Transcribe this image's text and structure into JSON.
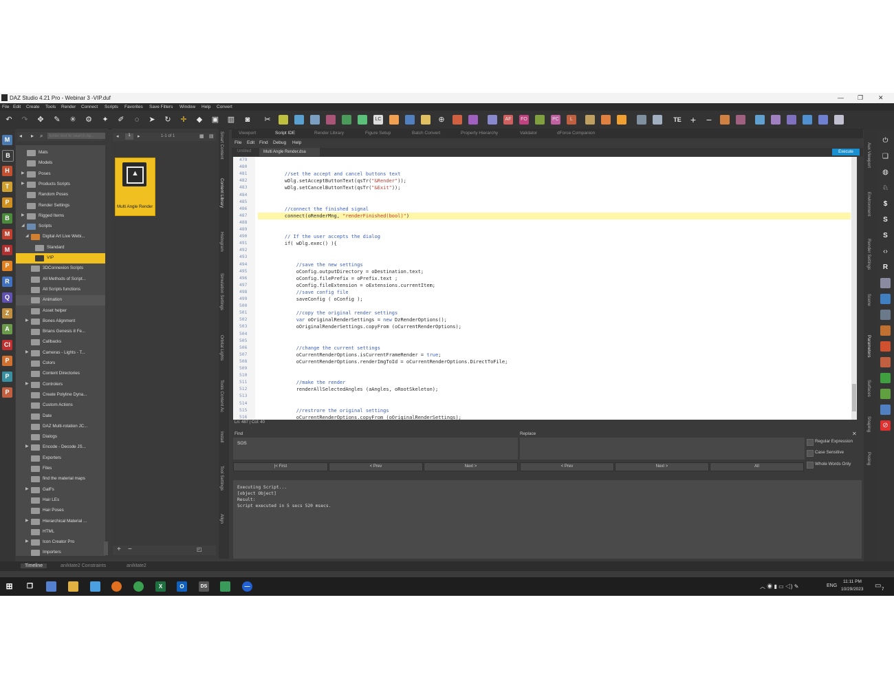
{
  "window": {
    "title": "DAZ Studio 4.21 Pro - Webinar 3 -VIP.duf",
    "minimize": "—",
    "maximize": "❐",
    "close": "✕"
  },
  "menu": [
    "File",
    "Edit",
    "Create",
    "Tools",
    "Render",
    "Connect",
    "Scripts",
    "Favorites",
    "Save Filters",
    "Window",
    "Help",
    "Convert"
  ],
  "left_icons": [
    "M",
    "B",
    "H",
    "T",
    "P",
    "B",
    "M",
    "M",
    "P",
    "R",
    "Q",
    "Z",
    "A",
    "Cl",
    "P",
    "P",
    "P"
  ],
  "content_library": {
    "search_placeholder": "Enter text to search by...",
    "items": [
      {
        "label": "Mats",
        "indent": 1,
        "arrow": ""
      },
      {
        "label": "Models",
        "indent": 1,
        "arrow": ""
      },
      {
        "label": "Poses",
        "indent": 1,
        "arrow": "▶"
      },
      {
        "label": "Products Scripts",
        "indent": 1,
        "arrow": "▶"
      },
      {
        "label": "Random Poses",
        "indent": 1,
        "arrow": ""
      },
      {
        "label": "Render Settings",
        "indent": 1,
        "arrow": ""
      },
      {
        "label": "Rigged Items",
        "indent": 1,
        "arrow": "▶"
      },
      {
        "label": "Scripts",
        "indent": 1,
        "arrow": "◢"
      },
      {
        "label": "Digital Art Live Webi...",
        "indent": 2,
        "arrow": "◢"
      },
      {
        "label": "Standard",
        "indent": 3,
        "arrow": ""
      },
      {
        "label": "VIP",
        "indent": 3,
        "arrow": "",
        "selected": true
      },
      {
        "label": "3DConnexion Scripts",
        "indent": 2,
        "arrow": ""
      },
      {
        "label": "All Methods of Script...",
        "indent": 2,
        "arrow": ""
      },
      {
        "label": "All Scripts functions",
        "indent": 2,
        "arrow": ""
      },
      {
        "label": "Animation",
        "indent": 2,
        "arrow": "",
        "highlight": true
      },
      {
        "label": "Asset helper",
        "indent": 2,
        "arrow": ""
      },
      {
        "label": "Bones Alignment",
        "indent": 2,
        "arrow": "▶"
      },
      {
        "label": "Brians Genesis 8 Fe...",
        "indent": 2,
        "arrow": ""
      },
      {
        "label": "Callbacks",
        "indent": 2,
        "arrow": ""
      },
      {
        "label": "Cameras - Lights - T...",
        "indent": 2,
        "arrow": "▶"
      },
      {
        "label": "Colors",
        "indent": 2,
        "arrow": ""
      },
      {
        "label": "Content Directories",
        "indent": 2,
        "arrow": ""
      },
      {
        "label": "Controlers",
        "indent": 2,
        "arrow": "▶"
      },
      {
        "label": "Create Polyline Dyna...",
        "indent": 2,
        "arrow": ""
      },
      {
        "label": "Custom Actions",
        "indent": 2,
        "arrow": ""
      },
      {
        "label": "Date",
        "indent": 2,
        "arrow": ""
      },
      {
        "label": "DAZ Multi-rotation JC...",
        "indent": 2,
        "arrow": ""
      },
      {
        "label": "Dialogs",
        "indent": 2,
        "arrow": ""
      },
      {
        "label": "Encode - Decode JS...",
        "indent": 2,
        "arrow": "▶"
      },
      {
        "label": "Exporters",
        "indent": 2,
        "arrow": ""
      },
      {
        "label": "Files",
        "indent": 2,
        "arrow": ""
      },
      {
        "label": "find the material maps",
        "indent": 2,
        "arrow": ""
      },
      {
        "label": "GalFs",
        "indent": 2,
        "arrow": "▶"
      },
      {
        "label": "Hair LEs",
        "indent": 2,
        "arrow": ""
      },
      {
        "label": "Hair Poses",
        "indent": 2,
        "arrow": ""
      },
      {
        "label": "Hierarchical Material ...",
        "indent": 2,
        "arrow": "▶"
      },
      {
        "label": "HTML",
        "indent": 2,
        "arrow": ""
      },
      {
        "label": "Icon Creator Pro",
        "indent": 2,
        "arrow": "▶"
      },
      {
        "label": "Importers",
        "indent": 2,
        "arrow": ""
      }
    ]
  },
  "thumbs": {
    "page": "1",
    "range": "1-1 of 1",
    "item_label": "Multi Angle Render"
  },
  "vtabs_left": [
    "Smart Content",
    "Content Library",
    "Histogram",
    "Simulation Settings",
    "Orbital Lights",
    "Tools Content Ac",
    "Install",
    "Tool Settings",
    "Align"
  ],
  "tabs": [
    "Viewport",
    "Script IDE",
    "Render Library",
    "Figure Setup",
    "Batch Convert",
    "Property Hierarchy",
    "Validator",
    "dForce Companion"
  ],
  "active_tab": "Script IDE",
  "ide_menu": [
    "File",
    "Edit",
    "Find",
    "Debug",
    "Help"
  ],
  "doc_tabs": [
    "Untitled",
    "Multi Angle Render.dsa"
  ],
  "execute_label": "Execute",
  "code": {
    "lines": [
      {
        "n": "479",
        "t": "",
        "c": ""
      },
      {
        "n": "480",
        "t": "",
        "c": ""
      },
      {
        "n": "481",
        "t": "    //set the accept and cancel buttons text",
        "c": "cm"
      },
      {
        "n": "482",
        "t": "    wDlg.setAcceptButtonText(qsTr(\"&Render\"));",
        "c": ""
      },
      {
        "n": "483",
        "t": "    wDlg.setCancelButtonText(qsTr(\"&Exit\"));",
        "c": ""
      },
      {
        "n": "484",
        "t": "",
        "c": ""
      },
      {
        "n": "485",
        "t": "",
        "c": ""
      },
      {
        "n": "486",
        "t": "    //connect the finished signal",
        "c": "cm"
      },
      {
        "n": "487",
        "t": "    connect(oRenderMng, \"renderFinished(bool)\")",
        "c": "",
        "hl": true
      },
      {
        "n": "488",
        "t": "",
        "c": ""
      },
      {
        "n": "489",
        "t": "",
        "c": ""
      },
      {
        "n": "490",
        "t": "    // If the user accepts the dialog",
        "c": "cm"
      },
      {
        "n": "491",
        "t": "    if( wDlg.exec() ){",
        "c": ""
      },
      {
        "n": "492",
        "t": "",
        "c": ""
      },
      {
        "n": "493",
        "t": "",
        "c": ""
      },
      {
        "n": "494",
        "t": "        //save the new settings",
        "c": "cm"
      },
      {
        "n": "495",
        "t": "        oConfig.outputDirectory = oDestination.text;",
        "c": ""
      },
      {
        "n": "496",
        "t": "        oConfig.filePrefix = oPrefix.text ;",
        "c": ""
      },
      {
        "n": "497",
        "t": "        oConfig.fileExtension = oExtensions.currentItem;",
        "c": ""
      },
      {
        "n": "498",
        "t": "        //save config file",
        "c": "cm"
      },
      {
        "n": "499",
        "t": "        saveConfig ( oConfig );",
        "c": ""
      },
      {
        "n": "500",
        "t": "",
        "c": ""
      },
      {
        "n": "501",
        "t": "        //copy the original render settings",
        "c": "cm"
      },
      {
        "n": "502",
        "t": "        var oOriginalRenderSettings = new DzRenderOptions();",
        "c": ""
      },
      {
        "n": "503",
        "t": "        oOriginalRenderSettings.copyFrom (oCurrentRenderOptions);",
        "c": ""
      },
      {
        "n": "504",
        "t": "",
        "c": ""
      },
      {
        "n": "505",
        "t": "",
        "c": ""
      },
      {
        "n": "506",
        "t": "        //change the current settings",
        "c": "cm"
      },
      {
        "n": "507",
        "t": "        oCurrentRenderOptions.isCurrentFrameRender = true;",
        "c": ""
      },
      {
        "n": "508",
        "t": "        oCurrentRenderOptions.renderImgToId = oCurrentRenderOptions.DirectToFile;",
        "c": ""
      },
      {
        "n": "509",
        "t": "",
        "c": ""
      },
      {
        "n": "510",
        "t": "",
        "c": ""
      },
      {
        "n": "511",
        "t": "        //make the render",
        "c": "cm"
      },
      {
        "n": "512",
        "t": "        renderAllSelectedAngles (aAngles, oRootSkeleton);",
        "c": ""
      },
      {
        "n": "513",
        "t": "",
        "c": ""
      },
      {
        "n": "514",
        "t": "",
        "c": ""
      },
      {
        "n": "515",
        "t": "        //restrore the original settings",
        "c": "cm"
      },
      {
        "n": "516",
        "t": "        oCurrentRenderOptions.copyFrom (oOriginalRenderSettings);",
        "c": ""
      }
    ]
  },
  "status": "Ln: 487 | Col: 40",
  "find": {
    "find_label": "Find",
    "replace_label": "Replace",
    "find_value": "SOS",
    "buttons_find": [
      "|< First",
      "< Prev",
      "Next >"
    ],
    "buttons_replace": [
      "< Prev",
      "Next >",
      "All"
    ],
    "options": [
      "Regular Expression",
      "Case Sensitive",
      "Whole Words Only"
    ]
  },
  "output": [
    "Executing Script...",
    "[object Object]",
    "Result:",
    "Script executed in 5 secs 520 msecs."
  ],
  "vtabs_right": [
    "Aux Viewport",
    "Environment",
    "Render Settings",
    "Scene",
    "Parameters",
    "Surfaces",
    "Shaping",
    "Posing"
  ],
  "bottom_tabs": [
    "Timeline",
    "aniMate2 Constraints",
    "aniMate2"
  ],
  "taskbar": {
    "lang": "ENG",
    "time": "11:11 PM",
    "date": "10/29/2023",
    "notif": "7"
  }
}
